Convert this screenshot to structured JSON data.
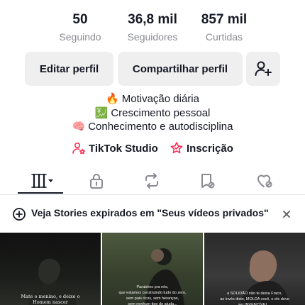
{
  "stats": {
    "following": {
      "value": "50",
      "label": "Seguindo"
    },
    "followers": {
      "value": "36,8 mil",
      "label": "Seguidores"
    },
    "likes": {
      "value": "857 mil",
      "label": "Curtidas"
    }
  },
  "actions": {
    "edit_label": "Editar perfil",
    "share_label": "Compartilhar perfil",
    "add_friend_icon": "add-user-icon"
  },
  "bio": {
    "lines": [
      {
        "emoji": "🔥",
        "text": "Motivação diária"
      },
      {
        "emoji": "💹",
        "text": "Crescimento pessoal"
      },
      {
        "emoji": "🧠",
        "text": "Conhecimento e autodisciplina"
      }
    ]
  },
  "links": {
    "studio_label": "TikTok Studio",
    "subscription_label": "Inscrição",
    "studio_color": "#fe2c55",
    "subscription_color": "#fe2c55"
  },
  "tabs": [
    {
      "name": "videos",
      "icon": "grid-icon",
      "active": true
    },
    {
      "name": "private",
      "icon": "lock-icon",
      "active": false
    },
    {
      "name": "reposts",
      "icon": "repost-icon",
      "active": false
    },
    {
      "name": "favorites",
      "icon": "bookmark-icon",
      "active": false
    },
    {
      "name": "liked",
      "icon": "heart-icon",
      "active": false
    }
  ],
  "banner": {
    "text": "Veja Stories expirados em \"Seus vídeos privados\"",
    "icon": "add-story-icon"
  },
  "videos": [
    {
      "caption": "Mate o menino, e deixe o\nHomem nascer"
    },
    {
      "caption": "Parabéns pra nós,\nque estamos construindo tudo do zero,\nsem pais ricos, sem heranças,\nsem nenhum tipo de ajuda..."
    },
    {
      "caption": "a SOLIDÃO não te deixa Fraco,\nao invés disto, MOLDA você, e ele deve\nser INVENCÍVEL..."
    }
  ]
}
